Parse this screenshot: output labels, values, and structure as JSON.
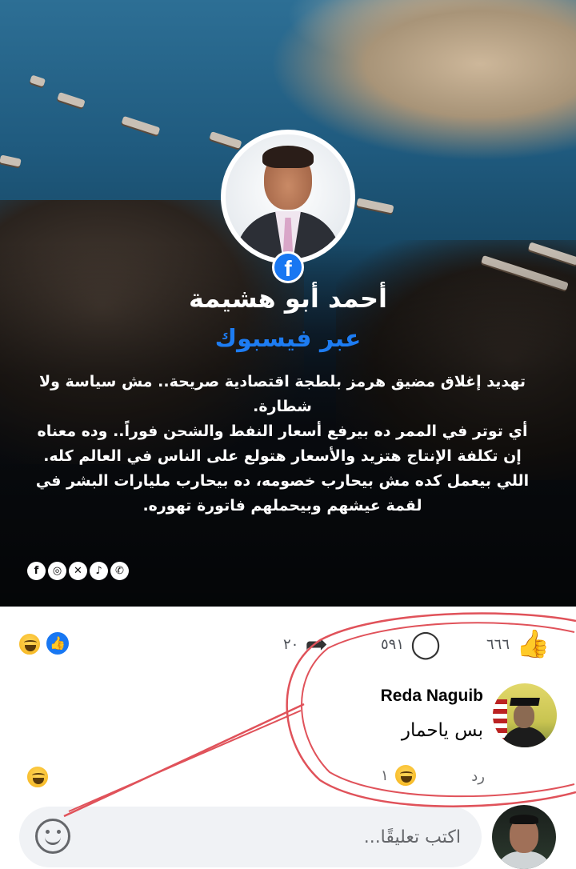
{
  "post": {
    "author_name": "أحمد أبو هشيمة",
    "via_label": "عبر فيسبوك",
    "text_lines": [
      "تهديد إغلاق مضيق هرمز بلطجة اقتصادية صريحة.. مش سياسة ولا شطارة.",
      "أي توتر في الممر ده بيرفع أسعار النفط والشحن فوراً.. وده معناه إن تكلفة الإنتاج هتزيد والأسعار هتولع على الناس في العالم كله.",
      "اللي بيعمل كده مش بيحارب خصومه، ده بيحارب مليارات البشر في لقمة عيشهم وبيحملهم فاتورة تهوره."
    ],
    "social_icons": [
      "facebook-icon",
      "instagram-icon",
      "x-icon",
      "tiktok-icon",
      "whatsapp-icon"
    ]
  },
  "reactions": {
    "likes_count": "٦٦٦",
    "comments_count": "٥٩١",
    "shares_count": "٢٠"
  },
  "comment": {
    "author": "Reda Naguib",
    "text": "بس ياحمار",
    "reply_label": "رد",
    "reaction_count": "١"
  },
  "composer": {
    "placeholder": "اكتب تعليقًا..."
  },
  "colors": {
    "facebook_blue": "#1877f2",
    "via_blue": "#1d7cf2",
    "annotation_red": "#e0525a"
  }
}
